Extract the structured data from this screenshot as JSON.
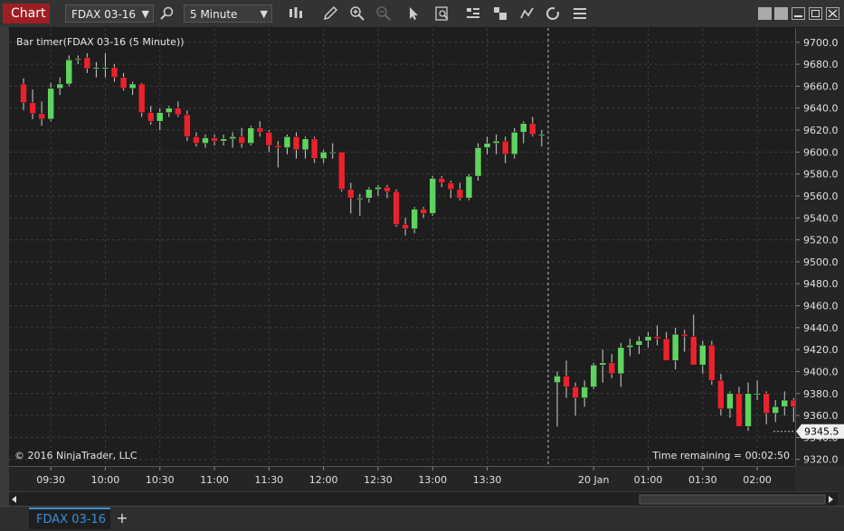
{
  "window": {
    "title_tab": "Chart",
    "instrument": "FDAX 03-16",
    "interval": "5 Minute"
  },
  "chart": {
    "indicator_label": "Bar timer(FDAX 03-16 (5 Minute))",
    "copyright": "© 2016 NinjaTrader, LLC",
    "time_remaining": "Time remaining = 00:02:50",
    "current_price_label": "9345.5",
    "colors": {
      "up": "#5fd35f",
      "down": "#e8232d",
      "wick": "#cfcfcf",
      "background": "#1e1e1e",
      "grid": "#3c3c3c",
      "price_marker": "#f0f0f0"
    }
  },
  "chart_data": {
    "type": "candlestick",
    "title": "FDAX 03-16 (5 Minute)",
    "y_ticks": [
      9700.0,
      9680.0,
      9660.0,
      9640.0,
      9620.0,
      9600.0,
      9580.0,
      9560.0,
      9540.0,
      9520.0,
      9500.0,
      9480.0,
      9460.0,
      9440.0,
      9420.0,
      9400.0,
      9380.0,
      9360.0,
      9340.0,
      9320.0
    ],
    "ylim": [
      9314,
      9713
    ],
    "x_ticks": [
      "09:30",
      "10:00",
      "10:30",
      "11:00",
      "11:30",
      "12:00",
      "12:30",
      "13:00",
      "13:30",
      "20 Jan",
      "01:00",
      "01:30",
      "02:00"
    ],
    "session_break_after_index": 57,
    "last_price": 9345.5,
    "candles": [
      [
        9662,
        9667,
        9638,
        9645
      ],
      [
        9645,
        9657,
        9630,
        9635
      ],
      [
        9635,
        9646,
        9624,
        9630
      ],
      [
        9630,
        9663,
        9628,
        9658
      ],
      [
        9658,
        9668,
        9652,
        9662
      ],
      [
        9662,
        9688,
        9660,
        9684
      ],
      [
        9684,
        9688,
        9680,
        9685
      ],
      [
        9686,
        9690,
        9672,
        9676
      ],
      [
        9676,
        9682,
        9668,
        9677
      ],
      [
        9677,
        9690,
        9668,
        9677
      ],
      [
        9677,
        9680,
        9664,
        9668
      ],
      [
        9668,
        9672,
        9656,
        9658
      ],
      [
        9658,
        9664,
        9652,
        9662
      ],
      [
        9662,
        9663,
        9632,
        9636
      ],
      [
        9636,
        9642,
        9625,
        9628
      ],
      [
        9628,
        9640,
        9620,
        9636
      ],
      [
        9636,
        9642,
        9632,
        9640
      ],
      [
        9640,
        9646,
        9632,
        9634
      ],
      [
        9634,
        9638,
        9610,
        9614
      ],
      [
        9614,
        9618,
        9605,
        9608
      ],
      [
        9608,
        9616,
        9604,
        9613
      ],
      [
        9613,
        9616,
        9606,
        9610
      ],
      [
        9610,
        9616,
        9606,
        9612
      ],
      [
        9612,
        9618,
        9604,
        9614
      ],
      [
        9614,
        9622,
        9604,
        9608
      ],
      [
        9608,
        9624,
        9606,
        9622
      ],
      [
        9622,
        9628,
        9614,
        9618
      ],
      [
        9618,
        9620,
        9600,
        9606
      ],
      [
        9606,
        9610,
        9586,
        9604
      ],
      [
        9604,
        9616,
        9598,
        9614
      ],
      [
        9614,
        9618,
        9594,
        9602
      ],
      [
        9602,
        9614,
        9594,
        9612
      ],
      [
        9612,
        9614,
        9590,
        9594
      ],
      [
        9594,
        9602,
        9590,
        9600
      ],
      [
        9600,
        9608,
        9594,
        9600
      ],
      [
        9600,
        9600,
        9564,
        9566
      ],
      [
        9566,
        9572,
        9544,
        9558
      ],
      [
        9558,
        9562,
        9542,
        9558
      ],
      [
        9558,
        9568,
        9554,
        9566
      ],
      [
        9566,
        9570,
        9560,
        9568
      ],
      [
        9568,
        9570,
        9558,
        9564
      ],
      [
        9564,
        9566,
        9532,
        9534
      ],
      [
        9534,
        9540,
        9524,
        9530
      ],
      [
        9530,
        9550,
        9526,
        9548
      ],
      [
        9548,
        9550,
        9540,
        9544
      ],
      [
        9544,
        9578,
        9542,
        9576
      ],
      [
        9576,
        9578,
        9568,
        9572
      ],
      [
        9572,
        9574,
        9558,
        9566
      ],
      [
        9566,
        9572,
        9556,
        9558
      ],
      [
        9558,
        9580,
        9556,
        9578
      ],
      [
        9578,
        9608,
        9574,
        9604
      ],
      [
        9604,
        9614,
        9598,
        9608
      ],
      [
        9608,
        9616,
        9598,
        9610
      ],
      [
        9610,
        9614,
        9590,
        9598
      ],
      [
        9598,
        9622,
        9594,
        9618
      ],
      [
        9618,
        9628,
        9608,
        9626
      ],
      [
        9626,
        9632,
        9614,
        9616
      ],
      [
        9616,
        9620,
        9605,
        9616
      ],
      [
        9390,
        9400,
        9350,
        9396
      ],
      [
        9396,
        9410,
        9376,
        9386
      ],
      [
        9386,
        9390,
        9360,
        9376
      ],
      [
        9376,
        9392,
        9368,
        9386
      ],
      [
        9386,
        9408,
        9384,
        9406
      ],
      [
        9406,
        9420,
        9390,
        9408
      ],
      [
        9408,
        9416,
        9394,
        9398
      ],
      [
        9398,
        9426,
        9386,
        9422
      ],
      [
        9422,
        9430,
        9414,
        9424
      ],
      [
        9424,
        9432,
        9416,
        9428
      ],
      [
        9428,
        9436,
        9422,
        9432
      ],
      [
        9432,
        9442,
        9424,
        9430
      ],
      [
        9430,
        9436,
        9418,
        9410
      ],
      [
        9410,
        9440,
        9402,
        9434
      ],
      [
        9434,
        9438,
        9418,
        9432
      ],
      [
        9432,
        9452,
        9412,
        9406
      ],
      [
        9406,
        9428,
        9398,
        9424
      ],
      [
        9424,
        9428,
        9388,
        9392
      ],
      [
        9392,
        9398,
        9360,
        9366
      ],
      [
        9366,
        9382,
        9358,
        9380
      ],
      [
        9380,
        9386,
        9350,
        9350
      ],
      [
        9350,
        9390,
        9346,
        9380
      ],
      [
        9380,
        9392,
        9374,
        9380
      ],
      [
        9380,
        9382,
        9352,
        9362
      ],
      [
        9362,
        9374,
        9354,
        9368
      ],
      [
        9368,
        9382,
        9360,
        9374
      ],
      [
        9374,
        9376,
        9354,
        9368
      ],
      [
        9368,
        9376,
        9340,
        9360
      ],
      [
        9360,
        9364,
        9340,
        9346
      ]
    ]
  }
}
